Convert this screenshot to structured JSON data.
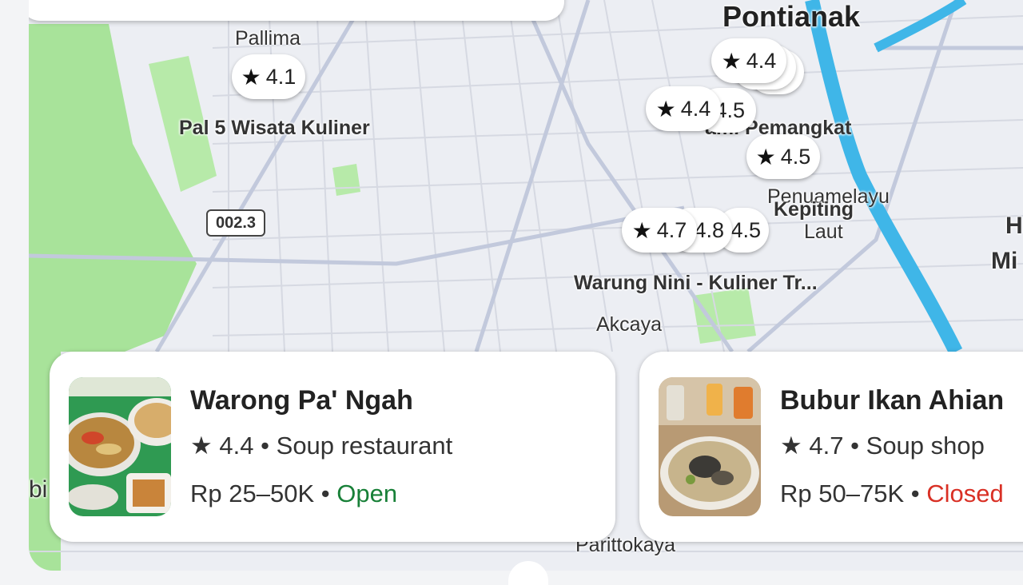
{
  "map": {
    "labels": {
      "city": "Pontianak",
      "pallima": "Pallima",
      "pal5": "Pal 5 Wisata Kuliner",
      "road": "002.3",
      "kami": "ami Pemangkat",
      "penumelayu": "Penuamelayu",
      "kepiting": "Kepiting",
      "laut": "Laut",
      "warung_nini": "Warung Nini - Kuliner Tr...",
      "akcaya": "Akcaya",
      "parittokaya": "Parittokaya",
      "edge_h": "H",
      "edge_mi": "Mi",
      "edge_bi": "bi"
    },
    "pins": {
      "p41": "4.1",
      "p44a": "4.4",
      "p44b": "4.4",
      "p45_hidden": "4.5",
      "p45": "4.5",
      "p47": "4.7",
      "p48": "4.8",
      "p45b": "4.5"
    },
    "star": "★"
  },
  "cards": [
    {
      "name": "Warong Pa' Ngah",
      "star": "★",
      "rating": "4.4",
      "sep1": "•",
      "category": "Soup restaurant",
      "price": "Rp 25–50K",
      "sep2": "•",
      "status": "Open"
    },
    {
      "name": "Bubur Ikan Ahian",
      "star": "★",
      "rating": "4.7",
      "sep1": "•",
      "category": "Soup shop",
      "price": "Rp 50–75K",
      "sep2": "•",
      "status": "Closed"
    }
  ],
  "colors": {
    "open": "#188038",
    "closed": "#d93025",
    "river": "#3fb6e8",
    "park": "#a8e39a"
  }
}
